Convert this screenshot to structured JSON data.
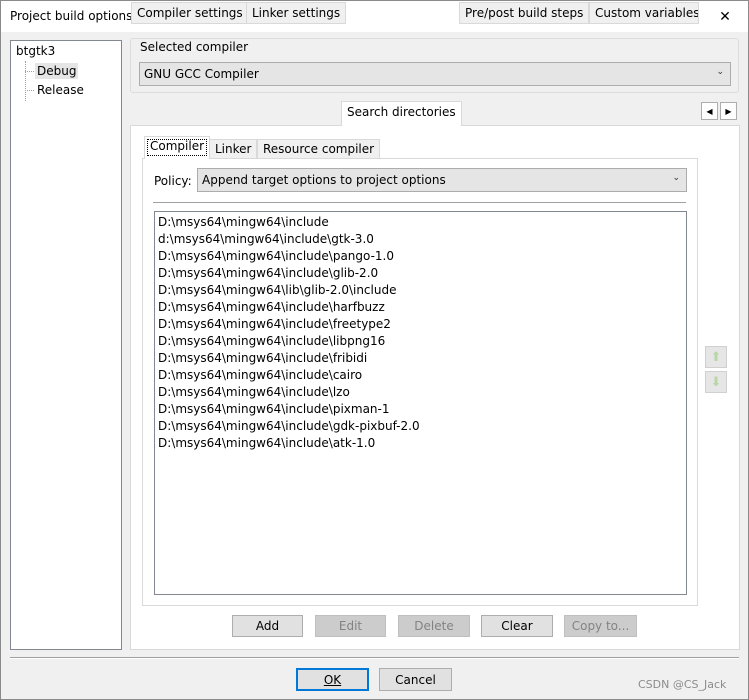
{
  "window": {
    "title": "Project build options"
  },
  "tree": {
    "root": "btgtk3",
    "children": [
      {
        "label": "Debug",
        "selected": true
      },
      {
        "label": "Release",
        "selected": false
      }
    ]
  },
  "compiler": {
    "group_label": "Selected compiler",
    "value": "GNU GCC Compiler"
  },
  "tabs": [
    {
      "label": "Compiler settings",
      "active": false
    },
    {
      "label": "Linker settings",
      "active": false
    },
    {
      "label": "Search directories",
      "active": true
    },
    {
      "label": "Pre/post build steps",
      "active": false
    },
    {
      "label": "Custom variables",
      "active": false
    }
  ],
  "subtabs": [
    {
      "label": "Compiler",
      "active": true
    },
    {
      "label": "Linker",
      "active": false
    },
    {
      "label": "Resource compiler",
      "active": false
    }
  ],
  "policy": {
    "label": "Policy:",
    "value": "Append target options to project options"
  },
  "directories": [
    "D:\\msys64\\mingw64\\include",
    "d:\\msys64\\mingw64\\include\\gtk-3.0",
    "D:\\msys64\\mingw64\\include\\pango-1.0",
    "D:\\msys64\\mingw64\\include\\glib-2.0",
    "D:\\msys64\\mingw64\\lib\\glib-2.0\\include",
    "D:\\msys64\\mingw64\\include\\harfbuzz",
    "D:\\msys64\\mingw64\\include\\freetype2",
    "D:\\msys64\\mingw64\\include\\libpng16",
    "D:\\msys64\\mingw64\\include\\fribidi",
    "D:\\msys64\\mingw64\\include\\cairo",
    "D:\\msys64\\mingw64\\include\\lzo",
    "D:\\msys64\\mingw64\\include\\pixman-1",
    "D:\\msys64\\mingw64\\include\\gdk-pixbuf-2.0",
    "D:\\msys64\\mingw64\\include\\atk-1.0"
  ],
  "actions": {
    "add": "Add",
    "edit": "Edit",
    "delete": "Delete",
    "clear": "Clear",
    "copy_to": "Copy to..."
  },
  "dialog": {
    "ok": "OK",
    "cancel": "Cancel"
  },
  "watermark": "CSDN @CS_Jack",
  "colors": {
    "move_arrow": "#b9d6a6",
    "default_button_border": "#0078d7"
  }
}
